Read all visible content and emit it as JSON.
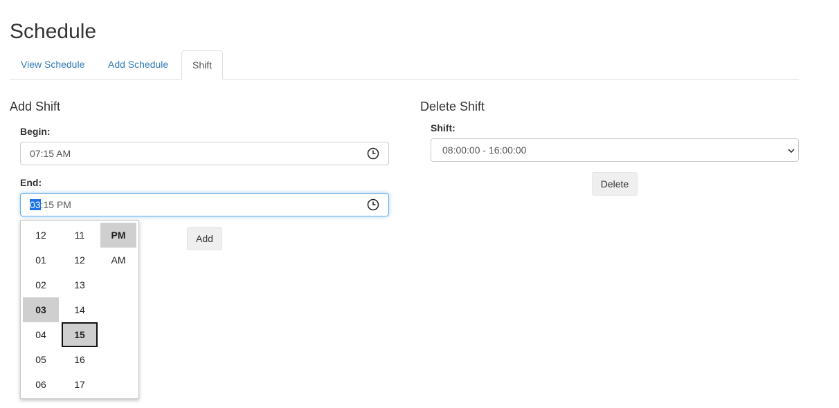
{
  "page": {
    "title": "Schedule"
  },
  "tabs": [
    "View Schedule",
    "Add Schedule",
    "Shift"
  ],
  "active_tab": "Shift",
  "add_shift": {
    "title": "Add Shift",
    "begin": {
      "label": "Begin:",
      "hour": "07",
      "minute": "15",
      "period": "AM"
    },
    "end": {
      "label": "End:",
      "hour": "03",
      "minute": "15",
      "period": "PM"
    },
    "add_button": "Add"
  },
  "delete_shift": {
    "title": "Delete Shift",
    "shift_label": "Shift:",
    "shift_selected": "08:00:00 - 16:00:00",
    "delete_button": "Delete"
  },
  "time_picker": {
    "hours": [
      "12",
      "01",
      "02",
      "03",
      "04",
      "05",
      "06"
    ],
    "minutes": [
      "11",
      "12",
      "13",
      "14",
      "15",
      "16",
      "17"
    ],
    "periods": [
      "PM",
      "AM"
    ],
    "selected_hour": "03",
    "selected_minute": "15",
    "selected_period": "PM"
  },
  "icons": {
    "time": "clock-icon",
    "dropdown": "chevron-down-icon"
  },
  "colors": {
    "link": "#337ab7",
    "focus_border": "#66afe9",
    "segment_highlight": "#1a73e8",
    "picker_selected": "#cfcfcf"
  }
}
